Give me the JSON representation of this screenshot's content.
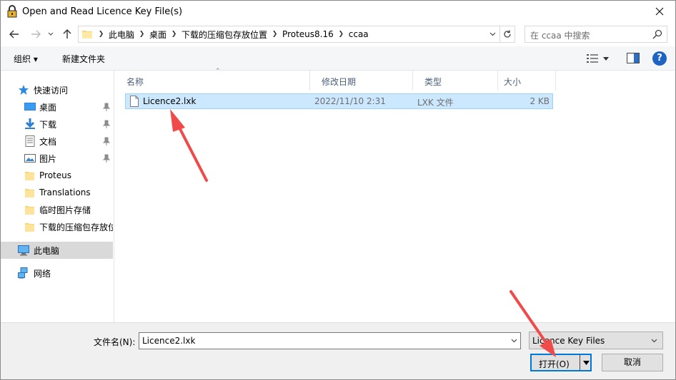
{
  "window": {
    "title": "Open and Read Licence Key File(s)"
  },
  "address": {
    "crumbs": [
      "此电脑",
      "桌面",
      "下载的压缩包存放位置",
      "Proteus8.16",
      "ccaa"
    ]
  },
  "search": {
    "placeholder": "在 ccaa 中搜索"
  },
  "toolbar": {
    "organize_label": "组织 ▾",
    "new_folder_label": "新建文件夹"
  },
  "navpane": {
    "quick_access": "快速访问",
    "items": [
      {
        "label": "桌面",
        "pinned": true
      },
      {
        "label": "下载",
        "pinned": true
      },
      {
        "label": "文档",
        "pinned": true
      },
      {
        "label": "图片",
        "pinned": true
      },
      {
        "label": "Proteus",
        "pinned": false
      },
      {
        "label": "Translations",
        "pinned": false
      },
      {
        "label": "临时图片存储",
        "pinned": false
      },
      {
        "label": "下载的压缩包存放位",
        "pinned": false
      }
    ],
    "this_pc": "此电脑",
    "network": "网络"
  },
  "filelist": {
    "columns": {
      "name": "名称",
      "modified": "修改日期",
      "type": "类型",
      "size": "大小"
    },
    "files": [
      {
        "name": "Licence2.lxk",
        "modified": "2022/11/10 2:31",
        "type": "LXK 文件",
        "size": "2 KB"
      }
    ]
  },
  "footer": {
    "filename_label": "文件名(N):",
    "filename_value": "Licence2.lxk",
    "filetype_value": "Licence Key Files",
    "open_label": "打开(O)",
    "cancel_label": "取消"
  },
  "colors": {
    "accent": "#0078d7",
    "selection_bg": "#cce8ff",
    "annotation_arrow": "#f04a4a",
    "folder": "#f8d775"
  }
}
